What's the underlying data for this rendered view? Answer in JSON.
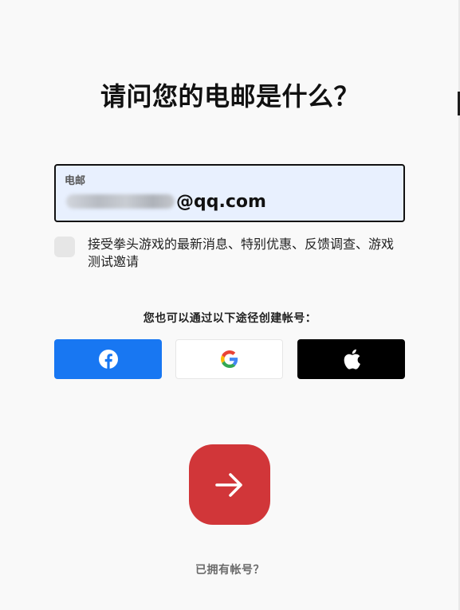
{
  "page": {
    "title": "请问您的电邮是什么？"
  },
  "email": {
    "label": "电邮",
    "value_visible": "@qq.com"
  },
  "consent": {
    "text": "接受拳头游戏的最新消息、特别优惠、反馈调查、游戏测试邀请",
    "checked": false
  },
  "alternatives": {
    "label": "您也可以通过以下途径创建帐号：",
    "buttons": [
      {
        "id": "facebook",
        "icon": "facebook-icon",
        "color": "#1877f2"
      },
      {
        "id": "google",
        "icon": "google-icon",
        "color": "#ffffff"
      },
      {
        "id": "apple",
        "icon": "apple-icon",
        "color": "#000000"
      }
    ]
  },
  "next": {
    "icon": "arrow-right-icon",
    "color": "#d13639"
  },
  "login": {
    "link_text": "已拥有帐号？"
  }
}
